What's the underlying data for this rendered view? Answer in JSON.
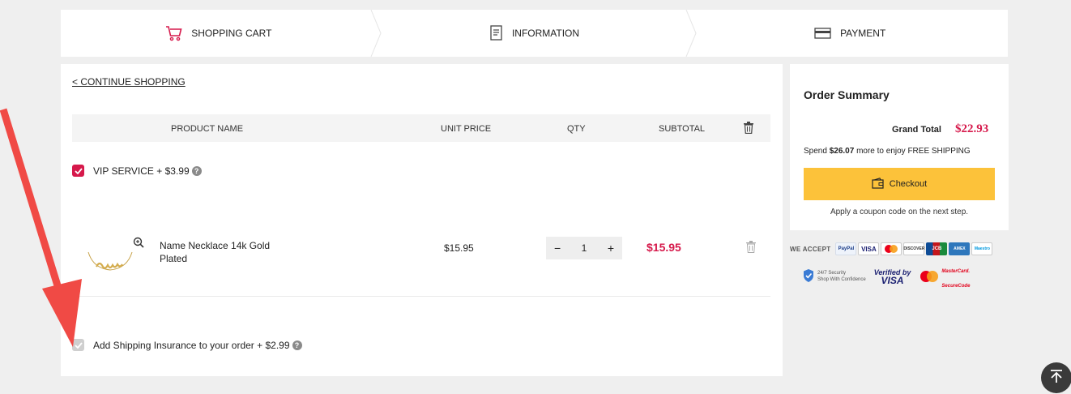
{
  "steps": [
    {
      "label": "SHOPPING CART",
      "icon": "cart-icon",
      "active": true
    },
    {
      "label": "INFORMATION",
      "icon": "document-icon",
      "active": false
    },
    {
      "label": "PAYMENT",
      "icon": "credit-card-icon",
      "active": false
    }
  ],
  "cart": {
    "continue_label": "< CONTINUE SHOPPING",
    "columns": {
      "name": "PRODUCT NAME",
      "unit": "UNIT PRICE",
      "qty": "QTY",
      "subtotal": "SUBTOTAL"
    },
    "vip_label": "VIP SERVICE + $3.99",
    "vip_checked": true,
    "item": {
      "name": "Name Necklace 14k Gold Plated",
      "unit_price": "$15.95",
      "qty": "1",
      "minus": "−",
      "plus": "+",
      "subtotal": "$15.95"
    },
    "insurance_label": "Add Shipping Insurance to your order + $2.99",
    "insurance_checked": true
  },
  "summary": {
    "title": "Order Summary",
    "grand_total_label": "Grand Total",
    "grand_total": "$22.93",
    "spend_prefix": "Spend",
    "spend_amount": "$26.07",
    "spend_suffix": "more to enjoy FREE SHIPPING",
    "checkout_label": "Checkout",
    "coupon_note": "Apply a coupon code on the next step."
  },
  "payment": {
    "accept_label": "WE ACCEPT",
    "cards": [
      "PayPal",
      "VISA",
      "MC",
      "DISCOVER",
      "JCB",
      "AMEX",
      "Maestro"
    ],
    "security_line1": "24/7 Security",
    "security_line2": "Shop With Confidence",
    "verified_line1": "Verified by",
    "verified_line2": "VISA",
    "securecode_line1": "MasterCard.",
    "securecode_line2": "SecureCode"
  },
  "colors": {
    "accent": "#d6194b",
    "checkout": "#fcc23a",
    "annotation_arrow": "#f04a45"
  }
}
